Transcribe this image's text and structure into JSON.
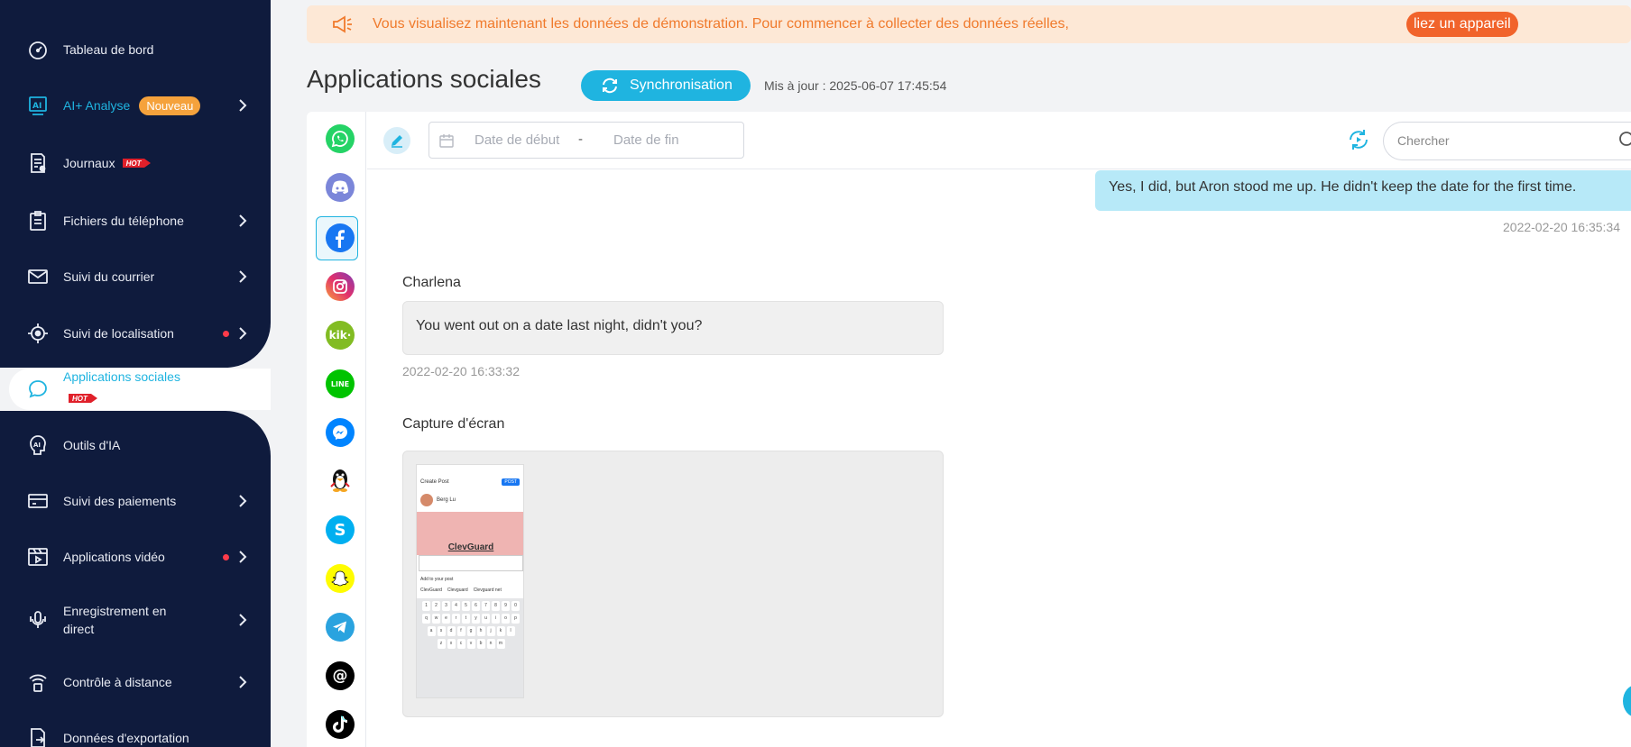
{
  "colors": {
    "accent": "#1fb4e0",
    "sidebar_bg": "#0f1b3d",
    "banner_bg": "#fde8d6",
    "banner_text": "#f07a2c",
    "banner_button": "#f1632b",
    "new_badge": "#f5a23c",
    "hot_badge": "#e0202a"
  },
  "banner": {
    "icon": "megaphone-icon",
    "text": "Vous visualisez maintenant les données de démonstration. Pour commencer à collecter des données réelles,",
    "link_label": "liez un appareil"
  },
  "sidebar": {
    "hot_label": "HOT",
    "new_label": "Nouveau",
    "items": [
      {
        "label": "Tableau de bord",
        "icon": "dashboard-gauge-icon"
      },
      {
        "label": "AI+ Analyse",
        "icon": "ai-icon",
        "badge": "Nouveau"
      },
      {
        "label": "Journaux",
        "icon": "log-document-icon",
        "badge": "HOT"
      },
      {
        "label": "Fichiers du téléphone",
        "icon": "clipboard-icon"
      },
      {
        "label": "Suivi du courrier",
        "icon": "mail-icon"
      },
      {
        "label": "Suivi de localisation",
        "icon": "location-target-icon"
      },
      {
        "label": "Applications sociales",
        "icon": "chat-bubble-icon",
        "badge": "HOT",
        "active": true
      },
      {
        "label": "Outils d'IA",
        "icon": "ai-head-icon"
      },
      {
        "label": "Suivi des paiements",
        "icon": "credit-card-icon"
      },
      {
        "label": "Applications vidéo",
        "icon": "video-icon"
      },
      {
        "label": "Enregistrement en",
        "label_line2": "direct",
        "icon": "microphone-icon"
      },
      {
        "label": "Contrôle à distance",
        "icon": "remote-signal-icon"
      },
      {
        "label": "Données d'exportation",
        "icon": "export-icon"
      }
    ]
  },
  "header": {
    "title": "Applications sociales",
    "sync_label": "Synchronisation",
    "updated": "Mis à jour : 2025-06-07 17:45:54"
  },
  "apps": [
    {
      "name": "whatsapp",
      "icon": "whatsapp-icon",
      "color": "#25d366"
    },
    {
      "name": "discord",
      "icon": "discord-icon",
      "color": "#5865f2"
    },
    {
      "name": "facebook",
      "icon": "facebook-icon",
      "color": "#1877f2",
      "selected": true
    },
    {
      "name": "instagram",
      "icon": "instagram-icon",
      "color": "#e1306c"
    },
    {
      "name": "kik",
      "icon": "kik-icon",
      "color": "#82bc23"
    },
    {
      "name": "line",
      "icon": "line-icon",
      "color": "#00c300"
    },
    {
      "name": "messenger",
      "icon": "messenger-icon",
      "color": "#0084ff"
    },
    {
      "name": "qq",
      "icon": "qq-penguin-icon",
      "color": "#111111"
    },
    {
      "name": "skype",
      "icon": "skype-icon",
      "color": "#00aff0"
    },
    {
      "name": "snapchat",
      "icon": "snapchat-icon",
      "color": "#fffc00"
    },
    {
      "name": "telegram",
      "icon": "telegram-icon",
      "color": "#2aa3df"
    },
    {
      "name": "threads",
      "icon": "threads-icon",
      "color": "#000000"
    },
    {
      "name": "tiktok",
      "icon": "tiktok-icon",
      "color": "#000000"
    }
  ],
  "toolbar": {
    "start_placeholder": "Date de début",
    "separator": "-",
    "end_placeholder": "Date de fin",
    "search_placeholder": "Chercher"
  },
  "chat": {
    "outgoing": {
      "text": "Yes, I did, but Aron stood me up. He didn't keep the date for the first time.",
      "time": "2022-02-20 16:35:34"
    },
    "incoming": {
      "sender": "Charlena",
      "text": "You went out on a date last night, didn't you?",
      "time": "2022-02-20 16:33:32"
    },
    "screenshot": {
      "label": "Capture d'écran",
      "phone_title": "Create Post",
      "phone_post_btn": "POST",
      "phone_user": "Berg Lu",
      "phone_brand": "ClevGuard",
      "phone_add": "Add to your post",
      "phone_suggest": [
        "ClevGuard",
        "Clevguard",
        "Clevguard net"
      ]
    }
  }
}
